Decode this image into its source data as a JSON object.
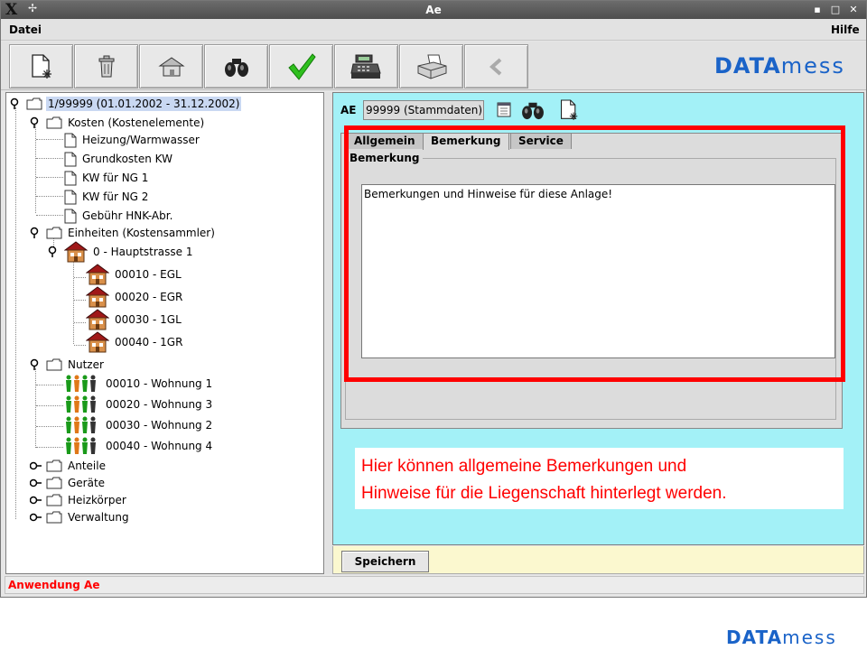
{
  "window": {
    "title": "Ae"
  },
  "menu": {
    "file": "Datei",
    "help": "Hilfe"
  },
  "brand": {
    "part1": "DATA",
    "part2": "mess"
  },
  "toolbar": {
    "buttons": [
      {
        "icon": "new-document-icon"
      },
      {
        "icon": "trash-icon"
      },
      {
        "icon": "home-icon"
      },
      {
        "icon": "binoculars-icon"
      },
      {
        "icon": "checkmark-icon"
      },
      {
        "icon": "cash-register-icon"
      },
      {
        "icon": "fax-printer-icon"
      },
      {
        "icon": "back-arrow-icon"
      }
    ]
  },
  "tree": {
    "root": "1/99999 (01.01.2002 - 31.12.2002)",
    "kosten": {
      "label": "Kosten (Kostenelemente)",
      "items": [
        "Heizung/Warmwasser",
        "Grundkosten KW",
        "KW für NG 1",
        "KW für NG 2",
        "Gebühr HNK-Abr."
      ]
    },
    "einheiten": {
      "label": "Einheiten (Kostensammler)",
      "house": "0 - Hauptstrasse 1",
      "items": [
        "00010 - EGL",
        "00020 - EGR",
        "00030 - 1GL",
        "00040 - 1GR"
      ]
    },
    "nutzer": {
      "label": "Nutzer",
      "items": [
        "00010 - Wohnung 1",
        "00020 - Wohnung 3",
        "00030 - Wohnung 2",
        "00040 - Wohnung 4"
      ]
    },
    "collapsed": [
      "Anteile",
      "Geräte",
      "Heizkörper",
      "Verwaltung"
    ]
  },
  "detail": {
    "ae_label": "AE",
    "ae_value": "99999 (Stammdaten)",
    "tabs": [
      "Allgemein",
      "Bemerkung",
      "Service"
    ],
    "active_tab": "Bemerkung",
    "group_title": "Bemerkung",
    "notes": "Bemerkungen und Hinweise für diese Anlage!"
  },
  "callout": {
    "line1": "Hier können allgemeine Bemerkungen und",
    "line2": "Hinweise für die Liegenschaft hinterlegt werden."
  },
  "save_button": "Speichern",
  "status": "Anwendung Ae",
  "colors": {
    "brand": "#1a63c8",
    "highlight": "#ff0000",
    "panel": "#a3f1f7"
  }
}
